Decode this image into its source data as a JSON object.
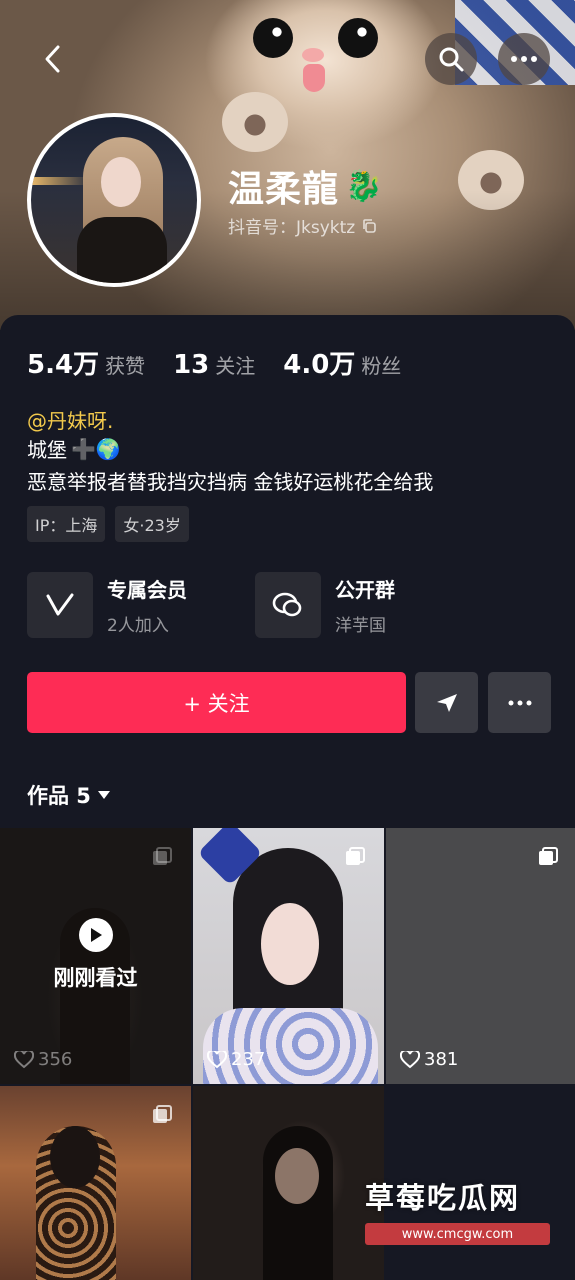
{
  "profile": {
    "name": "温柔龍",
    "name_emoji": "🐉",
    "douyin_id": "抖音号：Jksyktz"
  },
  "stats": [
    {
      "value": "5.4万",
      "label": "获赞"
    },
    {
      "value": "13",
      "label": "关注"
    },
    {
      "value": "4.0万",
      "label": "粉丝"
    }
  ],
  "bio": {
    "mention": "@丹妹呀.",
    "line1": "城堡",
    "line1_emoji": "➕🌍",
    "line2": "恶意举报者替我挡灾挡病  金钱好运桃花全给我"
  },
  "tags": [
    "IP：上海",
    "女·23岁"
  ],
  "features": [
    {
      "title": "专属会员",
      "subtitle": "2人加入"
    },
    {
      "title": "公开群",
      "subtitle": "洋芋国"
    }
  ],
  "actions": {
    "follow_label": "+ 关注"
  },
  "works": {
    "label": "作品 5"
  },
  "grid": [
    {
      "likes": "356",
      "watched_label": "刚刚看过"
    },
    {
      "likes": "237"
    },
    {
      "likes": "381"
    }
  ],
  "watermark": {
    "title": "草莓吃瓜网",
    "url": "www.cmcgw.com"
  },
  "colors": {
    "follow_button": "#fe2c55",
    "mention": "#f2c94c",
    "background": "#161823"
  }
}
